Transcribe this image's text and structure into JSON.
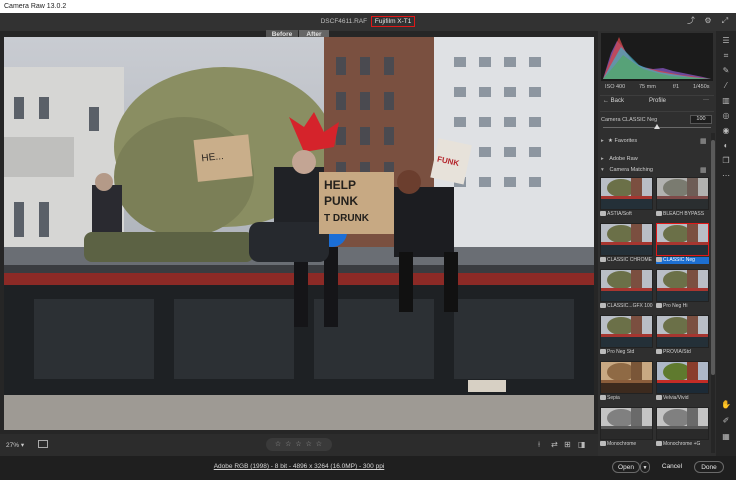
{
  "app": {
    "title": "Camera Raw 13.0.2"
  },
  "header": {
    "filename": "DSCF4611.RAF",
    "camera": "Fujifilm X-T1",
    "icons": [
      "export-icon",
      "gear-icon",
      "fullscreen-icon"
    ]
  },
  "view": {
    "before_label": "Before",
    "after_label": "After"
  },
  "photo": {
    "signs": {
      "left": "HE...",
      "center_1": "HELP",
      "center_2": "PUNK",
      "center_3": "T DRUNK",
      "right": "FUNK"
    }
  },
  "bottom": {
    "zoom": "27%",
    "stars": "☆ ☆ ☆ ☆ ☆",
    "workflow": "Adobe RGB (1998) - 8 bit - 4896 x 3264 (16.0MP) - 300 ppi",
    "open_label": "Open",
    "cancel_label": "Cancel",
    "done_label": "Done"
  },
  "histogram": {
    "iso": "ISO 400",
    "focal": "75 mm",
    "aperture": "f/1",
    "shutter": "1/450s"
  },
  "profile_panel": {
    "back_label": "Back",
    "title": "Profile",
    "current_profile": "Camera CLASSIC Neg",
    "amount": "100",
    "amount_fraction": 0.5,
    "groups": [
      "Favorites",
      "Adobe Raw",
      "Camera Matching"
    ]
  },
  "profiles": [
    {
      "name": "ASTIA/Soft",
      "selected": false,
      "tone": "color"
    },
    {
      "name": "BLEACH BYPASS",
      "selected": false,
      "tone": "muted"
    },
    {
      "name": "CLASSIC CHROME",
      "selected": false,
      "tone": "color"
    },
    {
      "name": "CLASSIC Neg",
      "selected": true,
      "tone": "color"
    },
    {
      "name": "CLASSIC...GFX 100",
      "selected": false,
      "tone": "color"
    },
    {
      "name": "Pro Neg Hi",
      "selected": false,
      "tone": "color"
    },
    {
      "name": "Pro Neg Std",
      "selected": false,
      "tone": "color"
    },
    {
      "name": "PROVIA/Std",
      "selected": false,
      "tone": "color"
    },
    {
      "name": "Sepia",
      "selected": false,
      "tone": "sepia"
    },
    {
      "name": "Velvia/Vivid",
      "selected": false,
      "tone": "vivid"
    },
    {
      "name": "Monochrome",
      "selected": false,
      "tone": "mono"
    },
    {
      "name": "Monochrome +G",
      "selected": false,
      "tone": "mono"
    }
  ],
  "colors": {
    "highlight_red": "#e01818",
    "selected_blue": "#1d6fd1",
    "panel_bg": "#2f2f2f"
  },
  "tools": [
    "sliders-icon",
    "crop-icon",
    "heal-icon",
    "brush-icon",
    "gradient-icon",
    "radial-icon",
    "redeye-icon",
    "presets-icon",
    "snapshots-icon",
    "more-icon"
  ],
  "bottom_tools": [
    "hand-icon",
    "color-sampler-icon",
    "grid-icon"
  ]
}
